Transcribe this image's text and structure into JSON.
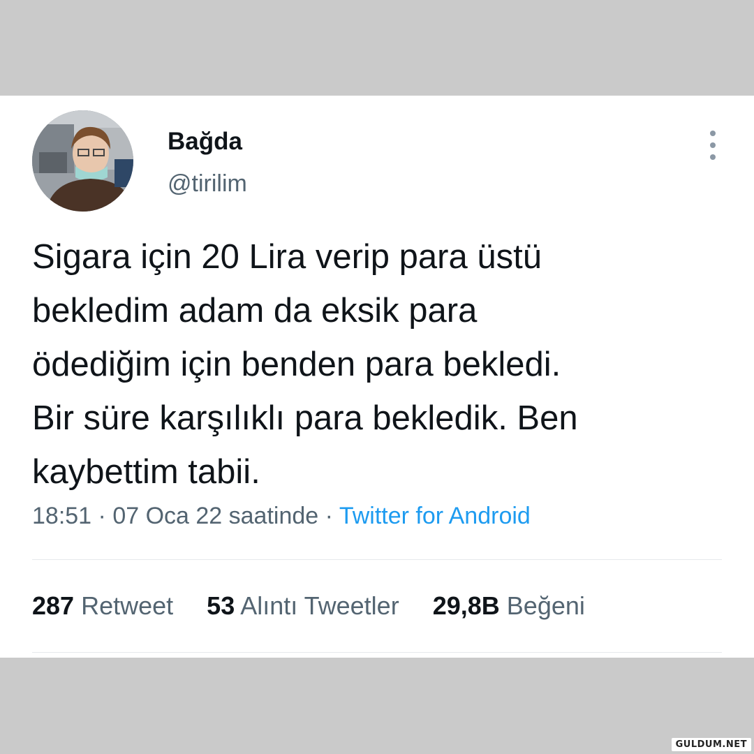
{
  "tweet": {
    "display_name": "Bağda",
    "handle": "@tirilim",
    "text_lines": [
      "Sigara için 20 Lira verip para üstü",
      "bekledim adam da eksik para",
      "ödediğim için benden para bekledi.",
      "Bir süre karşılıklı para bekledik. Ben",
      "kaybettim tabii."
    ],
    "time": "18:51",
    "separator": " · ",
    "date": "07 Oca 22 saatinde",
    "source": "Twitter for Android",
    "stats": {
      "retweets_count": "287",
      "retweets_label": "Retweet",
      "quotes_count": "53",
      "quotes_label": "Alıntı Tweetler",
      "likes_count": "29,8B",
      "likes_label": "Beğeni"
    }
  },
  "icons": {
    "more": "more-vertical-icon",
    "avatar": "profile-photo"
  },
  "watermark": "GULDUM.NET",
  "colors": {
    "background": "#cacaca",
    "card": "#ffffff",
    "text": "#0f1419",
    "secondary": "#536471",
    "link": "#1d9bf0"
  }
}
